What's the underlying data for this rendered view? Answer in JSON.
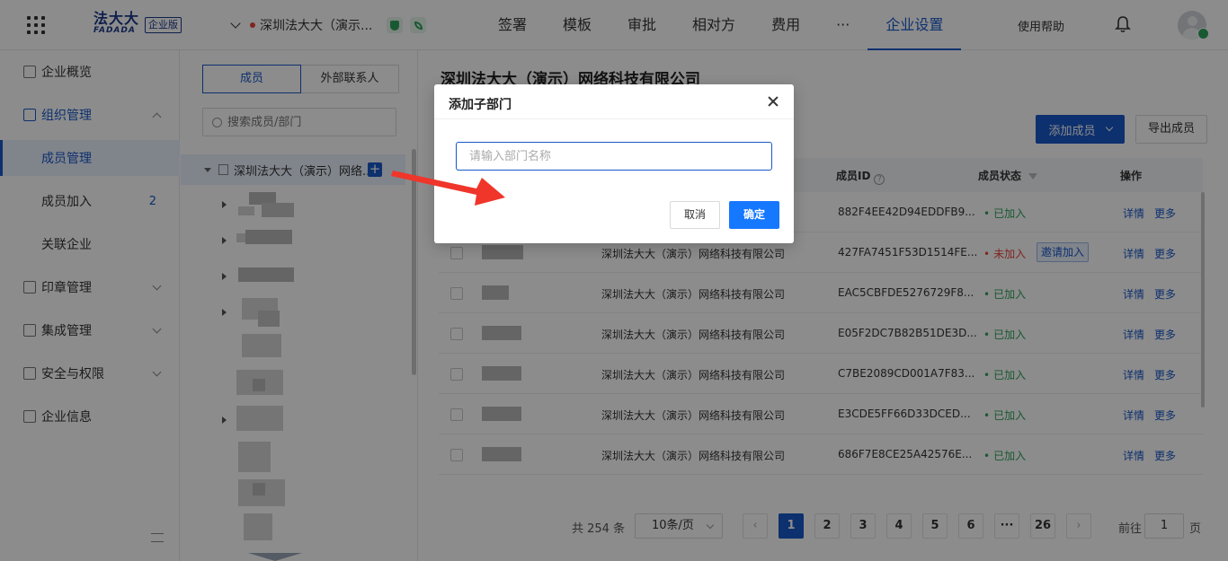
{
  "header": {
    "logo_cn": "法大大",
    "logo_en": "FADADA",
    "logo_badge": "企业版",
    "company": "深圳法大大（演示...",
    "nav": [
      "签署",
      "模板",
      "审批",
      "相对方",
      "费用",
      "···",
      "企业设置"
    ],
    "active_nav": "企业设置",
    "help": "使用帮助"
  },
  "sidebar": {
    "items": [
      {
        "label": "企业概览"
      },
      {
        "label": "组织管理"
      },
      {
        "label": "成员管理"
      },
      {
        "label": "成员加入",
        "count": "2"
      },
      {
        "label": "关联企业"
      },
      {
        "label": "印章管理"
      },
      {
        "label": "集成管理"
      },
      {
        "label": "安全与权限"
      },
      {
        "label": "企业信息"
      }
    ]
  },
  "tree": {
    "tabs": [
      "成员",
      "外部联系人"
    ],
    "search_placeholder": "搜索成员/部门",
    "root": "深圳法大大（演示）网络..."
  },
  "main": {
    "title": "深圳法大大（演示）网络科技有限公司",
    "add_member": "添加成员",
    "export": "导出成员",
    "columns": {
      "member_id": "成员ID",
      "status": "成员状态",
      "actions": "操作"
    },
    "rows": [
      {
        "company": "",
        "member_id": "882F4EE42D94EDDFB9...",
        "status": "已加入",
        "invite": ""
      },
      {
        "company": "深圳法大大（演示）网络科技有限公司",
        "member_id": "427FA7451F53D1514FE...",
        "status": "未加入",
        "invite": "邀请加入"
      },
      {
        "company": "深圳法大大（演示）网络科技有限公司",
        "member_id": "EAC5CBFDE5276729F8...",
        "status": "已加入",
        "invite": ""
      },
      {
        "company": "深圳法大大（演示）网络科技有限公司",
        "member_id": "E05F2DC7B82B51DE3D...",
        "status": "已加入",
        "invite": ""
      },
      {
        "company": "深圳法大大（演示）网络科技有限公司",
        "member_id": "C7BE2089CD001A7F83...",
        "status": "已加入",
        "invite": ""
      },
      {
        "company": "深圳法大大（演示）网络科技有限公司",
        "member_id": "E3CDE5FF66D33DCED...",
        "status": "已加入",
        "invite": ""
      },
      {
        "company": "深圳法大大（演示）网络科技有限公司",
        "member_id": "686F7E8CE25A42576E...",
        "status": "已加入",
        "invite": ""
      }
    ],
    "action_detail": "详情",
    "action_more": "更多"
  },
  "pager": {
    "total": "共 254 条",
    "page_size": "10条/页",
    "pages": [
      "1",
      "2",
      "3",
      "4",
      "5",
      "6",
      "···",
      "26"
    ],
    "current": "1",
    "goto_label": "前往",
    "goto_value": "1",
    "page_unit": "页"
  },
  "modal": {
    "title": "添加子部门",
    "input_placeholder": "请输入部门名称",
    "cancel": "取消",
    "ok": "确定"
  },
  "colors": {
    "primary": "#1858c9",
    "success": "#2fa35a",
    "danger": "#e8453c",
    "annotation_arrow": "#f0352a"
  }
}
